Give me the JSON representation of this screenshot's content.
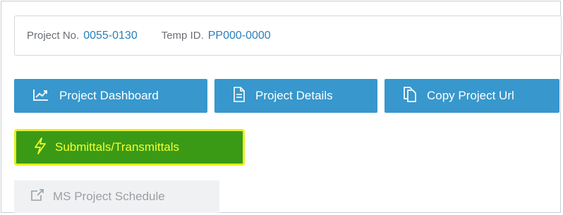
{
  "project_info": {
    "project_no_label": "Project No.",
    "project_no_value": "0055-0130",
    "temp_id_label": "Temp ID.",
    "temp_id_value": "PP000-0000"
  },
  "actions": {
    "dashboard_label": "Project Dashboard",
    "details_label": "Project Details",
    "copy_url_label": "Copy Project Url",
    "submittals_label": "Submittals/Transmittals",
    "ms_project_label": "MS Project Schedule"
  },
  "icons": {
    "dashboard": "line-chart-icon",
    "details": "document-icon",
    "copy": "copy-icon",
    "submittals": "lightning-icon",
    "ms_project": "external-link-icon"
  },
  "colors": {
    "primary_button": "#3897cc",
    "highlight_button": "#3a9a16",
    "highlight_border": "#e4ef1f",
    "highlight_text": "#f3ff2e",
    "disabled_button": "#f0f1f2",
    "value_text": "#2a7fb9"
  }
}
